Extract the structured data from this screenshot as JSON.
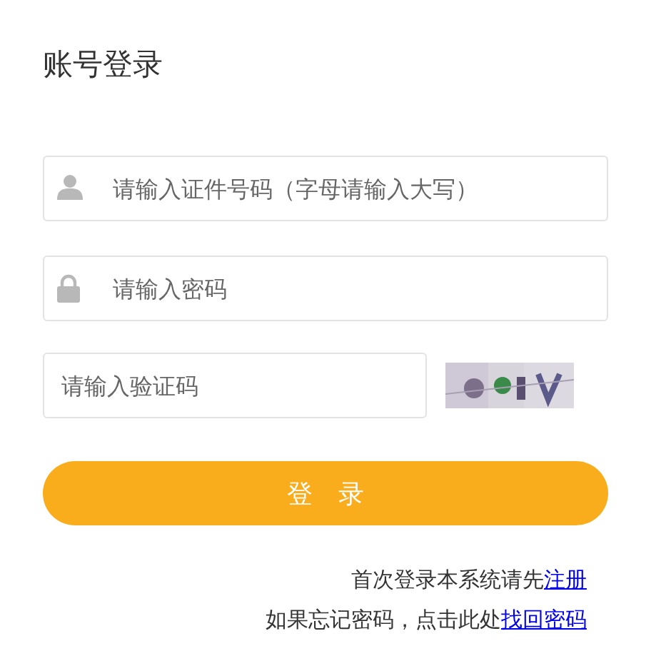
{
  "title": "账号登录",
  "fields": [
    {
      "kind": "user",
      "placeholder": "请输入证件号码（字母请输入大写）"
    },
    {
      "kind": "lock",
      "placeholder": "请输入密码"
    }
  ],
  "captcha": {
    "placeholder": "请输入验证码",
    "kind": "picture"
  },
  "submit": "登　录",
  "links": [
    {
      "text": "首次登录本系统请先",
      "link": "注册"
    },
    {
      "text": "如果忘记密码，点击此处",
      "link": "找回密码"
    }
  ]
}
